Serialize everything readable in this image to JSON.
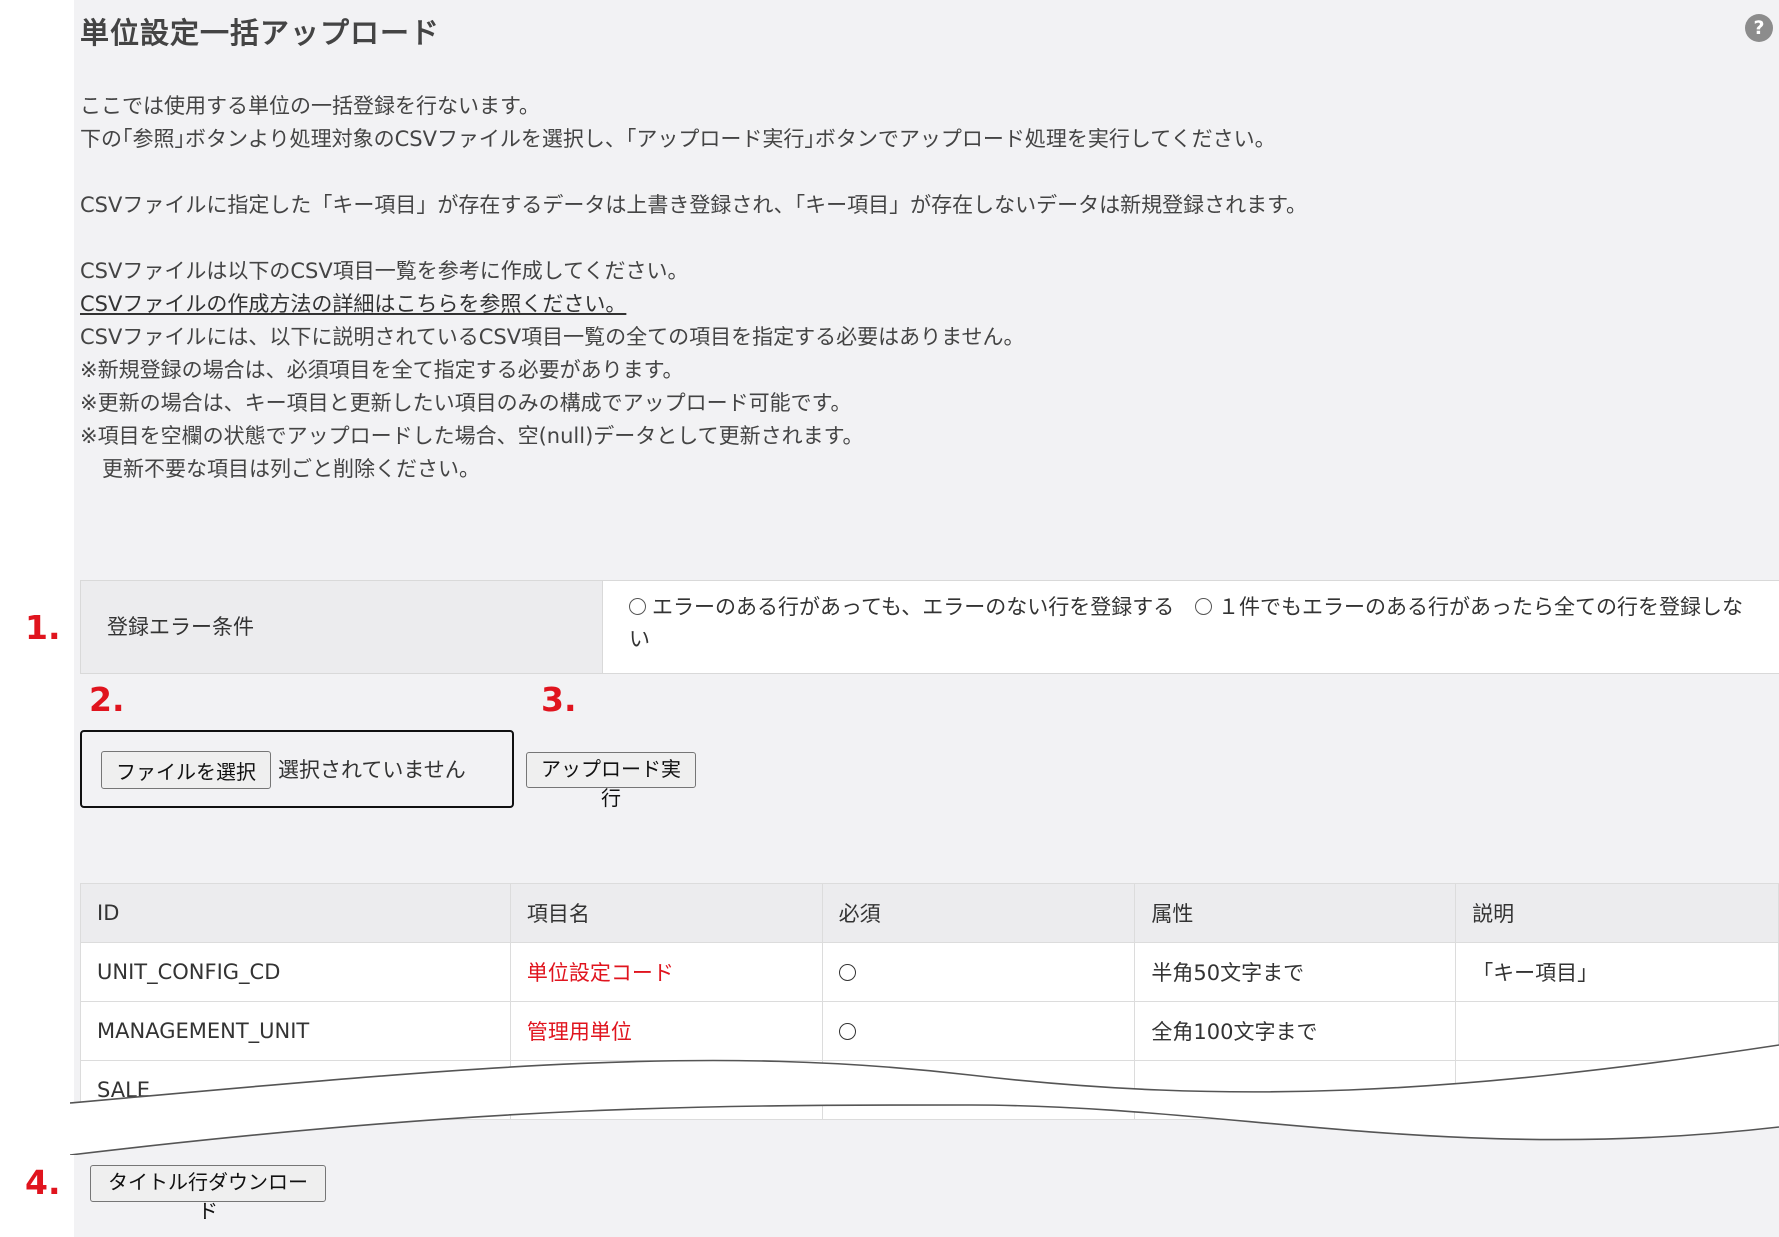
{
  "page": {
    "title": "単位設定一括アップロード",
    "help_icon_glyph": "?"
  },
  "intro": {
    "line1": "ここでは使用する単位の一括登録を行ないます。",
    "line2": "下の｢参照｣ボタンより処理対象のCSVファイルを選択し、｢アップロード実行｣ボタンでアップロード処理を実行してください。",
    "line3": "CSVファイルに指定した「キー項目」が存在するデータは上書き登録され、「キー項目」が存在しないデータは新規登録されます。",
    "line4": "CSVファイルは以下のCSV項目一覧を参考に作成してください。",
    "link": "CSVファイルの作成方法の詳細はこちらを参照ください。",
    "line5": "CSVファイルには、以下に説明されているCSV項目一覧の全ての項目を指定する必要はありません。",
    "line6": "※新規登録の場合は、必須項目を全て指定する必要があります。",
    "line7": "※更新の場合は、キー項目と更新したい項目のみの構成でアップロード可能です。",
    "line8": "※項目を空欄の状態でアップロードした場合、空(null)データとして更新されます。",
    "line9": "更新不要な項目は列ごと削除ください。"
  },
  "steps": {
    "s1": "1.",
    "s2": "2.",
    "s3": "3.",
    "s4": "4."
  },
  "error_condition": {
    "label": "登録エラー条件",
    "option1": "エラーのある行があっても、エラーのない行を登録する",
    "option2": "１件でもエラーのある行があったら全ての行を登録しない"
  },
  "file": {
    "choose_button": "ファイルを選択",
    "status": "選択されていません"
  },
  "upload_button": "アップロード実行",
  "csv_table": {
    "headers": [
      "ID",
      "項目名",
      "必須",
      "属性",
      "説明"
    ],
    "rows": [
      {
        "id": "UNIT_CONFIG_CD",
        "name": "単位設定コード",
        "required": "○",
        "attr": "半角50文字まで",
        "desc": "「キー項目」"
      },
      {
        "id": "MANAGEMENT_UNIT",
        "name": "管理用単位",
        "required": "○",
        "attr": "全角100文字まで",
        "desc": ""
      },
      {
        "id": "SALE",
        "name": "",
        "required": "○",
        "attr": "",
        "desc": ""
      }
    ]
  },
  "download_button": "タイトル行ダウンロード",
  "colors": {
    "step_red": "#e0141e",
    "item_name_red": "#e0141e",
    "panel_bg": "#f2f2f4"
  }
}
